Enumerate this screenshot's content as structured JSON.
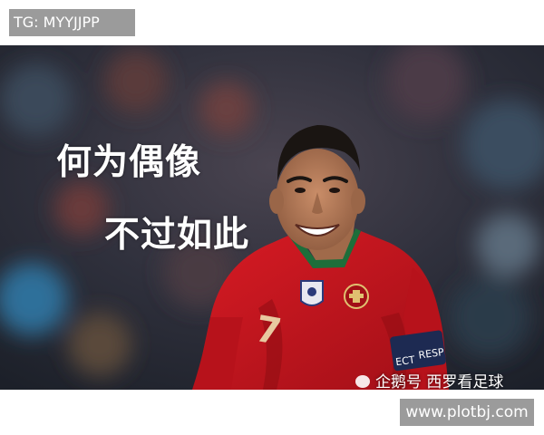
{
  "top_tag": {
    "text": "TG: MYYJJPP"
  },
  "photo": {
    "caption_line_1": "何为偶像",
    "caption_line_2": "不过如此",
    "jersey_number": "7",
    "sleeve_text": "ECT",
    "badge_text": "RESP",
    "watermark": "企鹅号 西罗看足球",
    "wechat_icon": "wechat-bubble-icon",
    "colors": {
      "jersey": "#c8141e",
      "jersey_dark": "#8e0c12",
      "collar": "#1d6e3a",
      "number": "#e8c9a0",
      "skin": "#b07a5a",
      "hair": "#1a1512",
      "background": "#2a2d38"
    }
  },
  "bottom_tag": {
    "text": "www.plotbj.com"
  }
}
